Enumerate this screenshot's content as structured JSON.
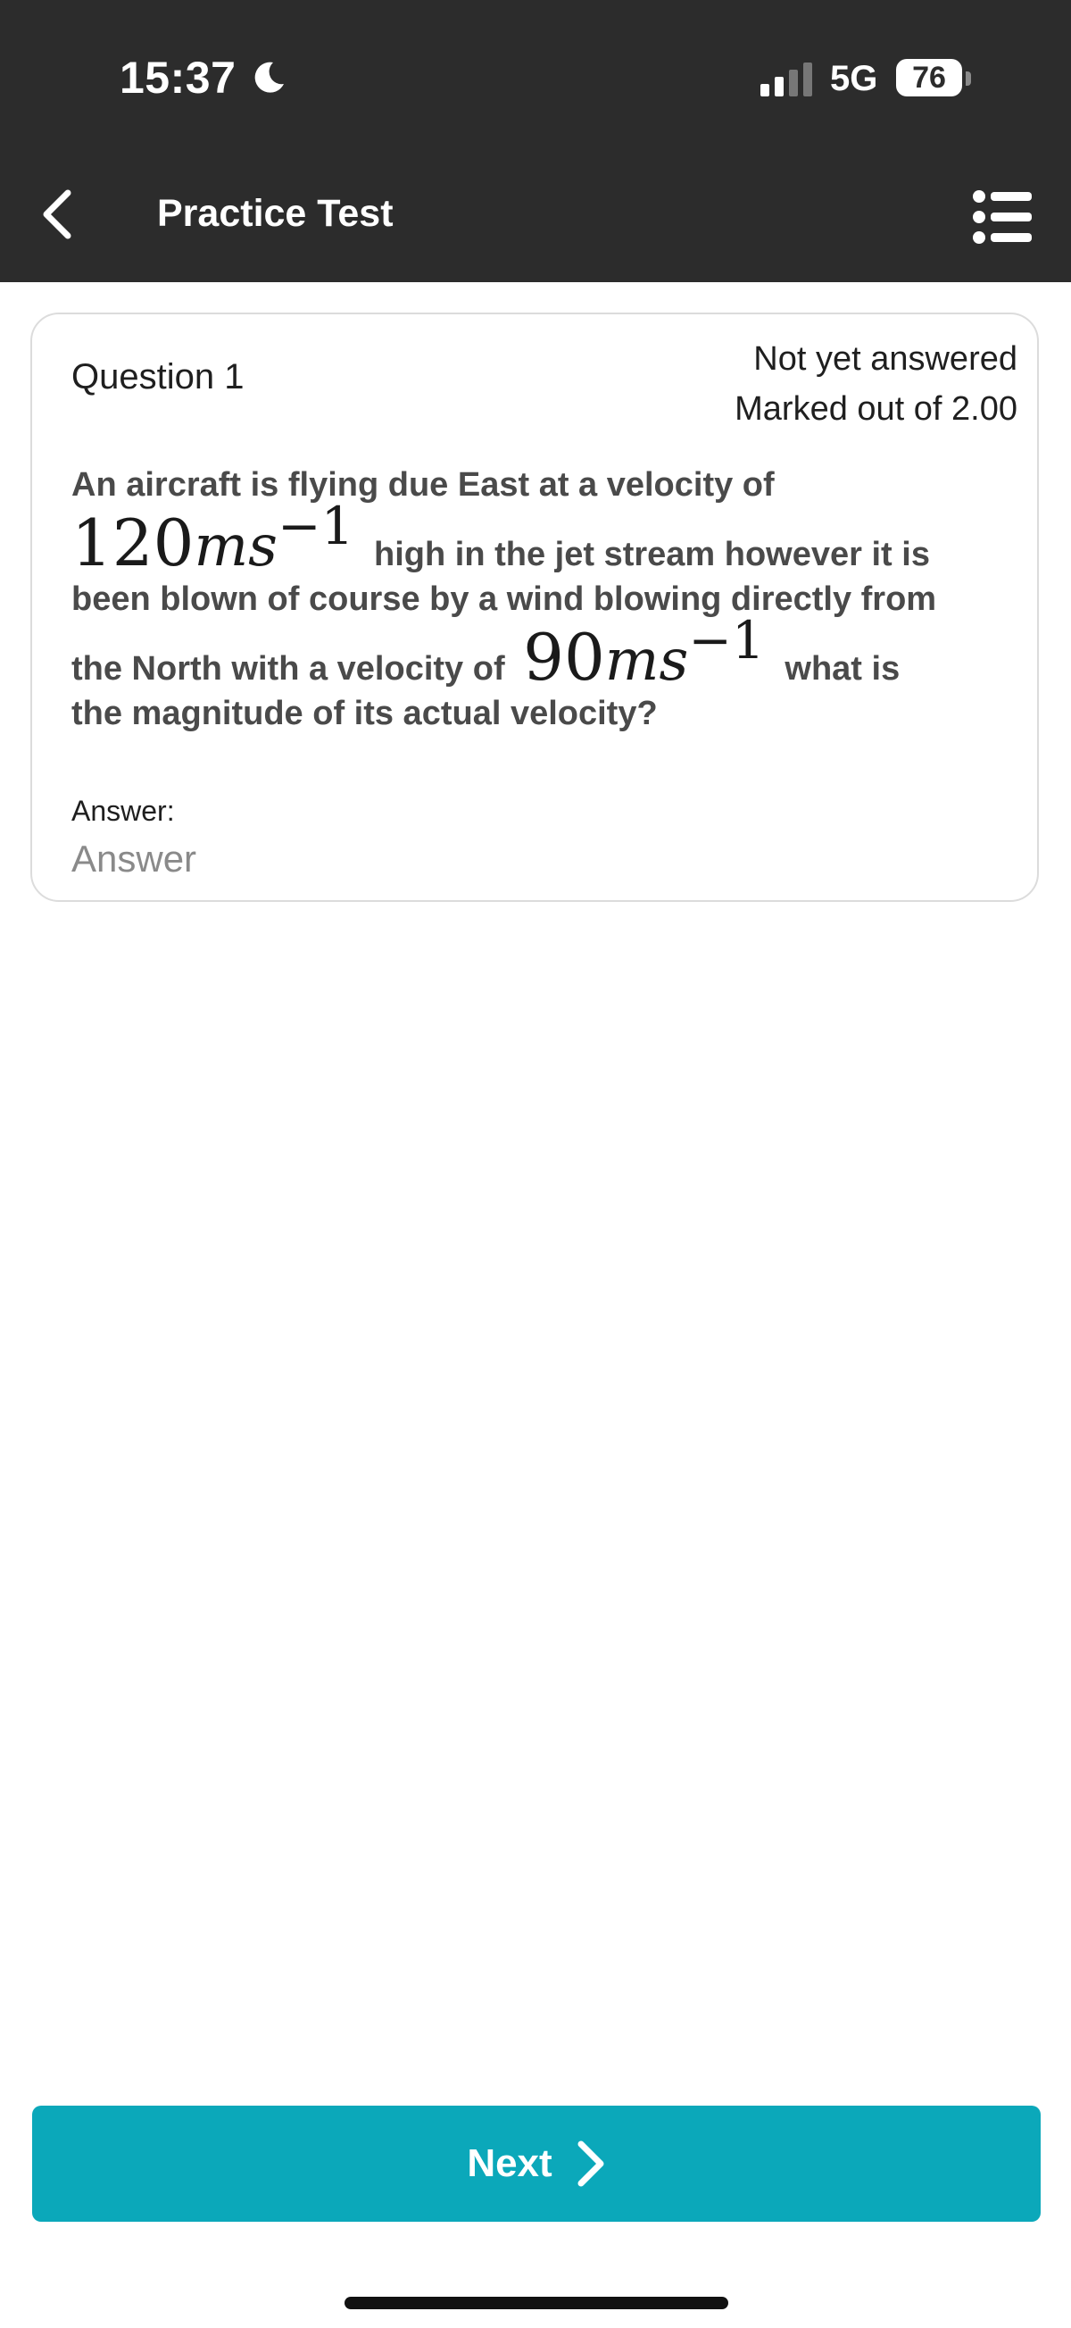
{
  "status_bar": {
    "time": "15:37",
    "network": "5G",
    "battery": "76"
  },
  "header": {
    "title": "Practice Test"
  },
  "question": {
    "number_label": "Question 1",
    "state": "Not yet answered",
    "marks": "Marked out of 2.00",
    "text": {
      "part1": "An aircraft is flying due East at a velocity of",
      "math1": {
        "number": "120",
        "unit": "ms",
        "exponent": "−1"
      },
      "part2": "high in the jet stream however it is",
      "part3": "been blown of course by a wind blowing directly from",
      "part4": "the North with a velocity of",
      "math2": {
        "number": "90",
        "unit": "ms",
        "exponent": "−1"
      },
      "part5": "what is",
      "part6": "the magnitude of its actual velocity?"
    },
    "answer_label": "Answer:",
    "answer_placeholder": "Answer",
    "answer_value": ""
  },
  "footer": {
    "next_label": "Next"
  },
  "colors": {
    "topbar": "#2c2c2c",
    "accent": "#0ba8ba",
    "card_border": "#dcdcdc"
  }
}
